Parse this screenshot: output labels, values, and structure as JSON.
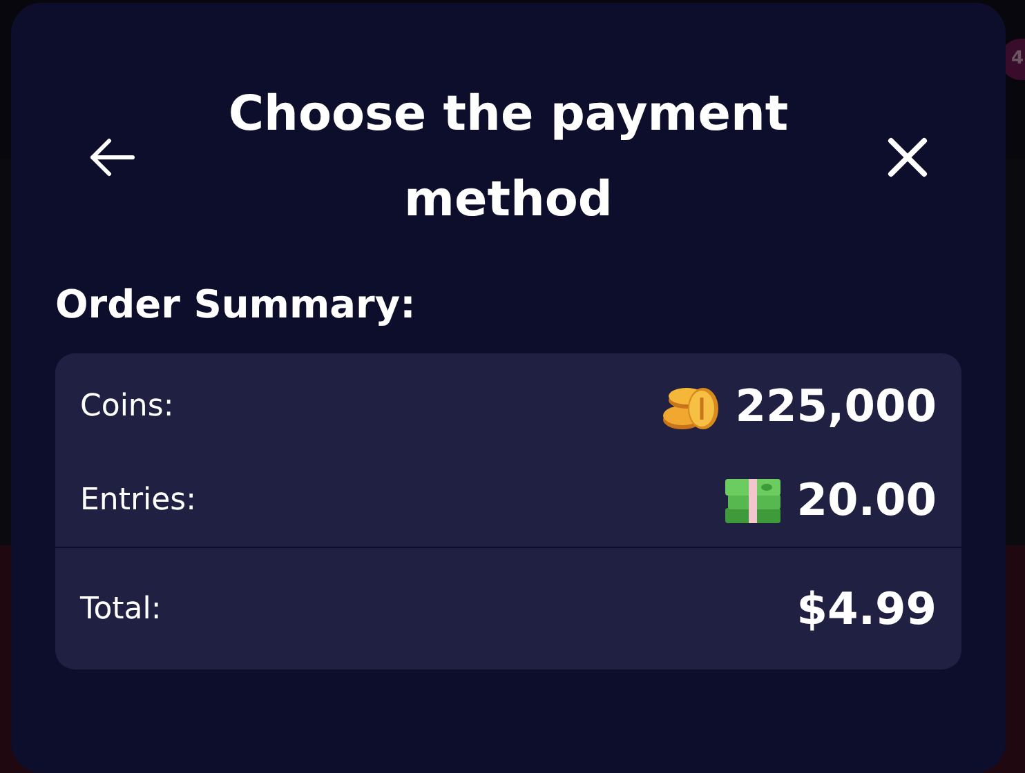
{
  "background": {
    "badge": "4"
  },
  "dialog": {
    "title": "Choose the payment method"
  },
  "order_summary": {
    "heading": "Order Summary:",
    "rows": [
      {
        "kind": "coins",
        "label": "Coins:",
        "value": "225,000"
      },
      {
        "kind": "entries",
        "label": "Entries:",
        "value": "20.00"
      }
    ],
    "total": {
      "label": "Total:",
      "value": "$4.99"
    }
  }
}
